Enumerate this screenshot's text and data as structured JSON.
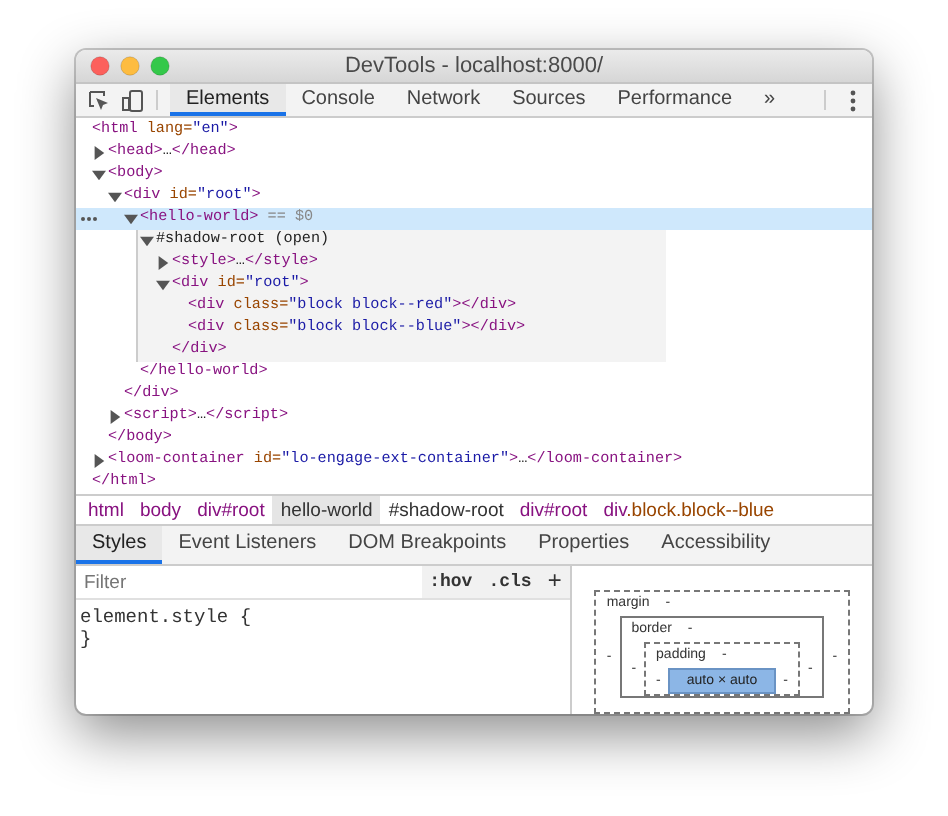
{
  "window": {
    "title": "DevTools - localhost:8000/"
  },
  "main_tabs": [
    {
      "label": "Elements",
      "selected": true
    },
    {
      "label": "Console",
      "selected": false
    },
    {
      "label": "Network",
      "selected": false
    },
    {
      "label": "Sources",
      "selected": false
    },
    {
      "label": "Performance",
      "selected": false
    },
    {
      "label": "»",
      "selected": false
    }
  ],
  "dom_tree": [
    {
      "selected": false,
      "tokens": [
        {
          "kind": "tag",
          "text": "<html"
        },
        {
          "kind": "attr",
          "text": "lang="
        },
        {
          "kind": "value",
          "text": "\"en\""
        },
        {
          "kind": "tag",
          "text": ">"
        }
      ],
      "close": "</html>",
      "children": [
        {
          "selected": false,
          "expanded": false,
          "tokens": [
            {
              "kind": "tag",
              "text": "<head>"
            },
            {
              "kind": "plain",
              "text": "…"
            },
            {
              "kind": "tag",
              "text": "</head>"
            }
          ]
        },
        {
          "selected": false,
          "expanded": true,
          "tokens": [
            {
              "kind": "tag",
              "text": "<body>"
            }
          ],
          "close": "</body>",
          "children": [
            {
              "selected": false,
              "expanded": true,
              "tokens": [
                {
                  "kind": "tag",
                  "text": "<div"
                },
                {
                  "kind": "attr",
                  "text": "id="
                },
                {
                  "kind": "value",
                  "text": "\"root\""
                },
                {
                  "kind": "tag",
                  "text": ">"
                }
              ],
              "close": "</div>",
              "children": [
                {
                  "selected": true,
                  "expanded": true,
                  "tokens": [
                    {
                      "kind": "tag",
                      "text": "<hello-world>"
                    },
                    {
                      "kind": "hint",
                      "text": "== $0"
                    }
                  ],
                  "close": "</hello-world>",
                  "children": [
                    {
                      "selected": false,
                      "expanded": true,
                      "kind": "shadow",
                      "tokens": [
                        {
                          "kind": "plain",
                          "text": "#shadow-root (open)"
                        }
                      ],
                      "children": [
                        {
                          "selected": false,
                          "expanded": false,
                          "tokens": [
                            {
                              "kind": "tag",
                              "text": "<style>"
                            },
                            {
                              "kind": "plain",
                              "text": "…"
                            },
                            {
                              "kind": "tag",
                              "text": "</style>"
                            }
                          ]
                        },
                        {
                          "selected": false,
                          "expanded": true,
                          "tokens": [
                            {
                              "kind": "tag",
                              "text": "<div"
                            },
                            {
                              "kind": "attr",
                              "text": "id="
                            },
                            {
                              "kind": "value",
                              "text": "\"root\""
                            },
                            {
                              "kind": "tag",
                              "text": ">"
                            }
                          ],
                          "close": "</div>",
                          "children": [
                            {
                              "selected": false,
                              "tokens": [
                                {
                                  "kind": "tag",
                                  "text": "<div"
                                },
                                {
                                  "kind": "attr",
                                  "text": "class="
                                },
                                {
                                  "kind": "value",
                                  "text": "\"block block--red\""
                                },
                                {
                                  "kind": "tag",
                                  "text": "></div>"
                                }
                              ]
                            },
                            {
                              "selected": false,
                              "tokens": [
                                {
                                  "kind": "tag",
                                  "text": "<div"
                                },
                                {
                                  "kind": "attr",
                                  "text": "class="
                                },
                                {
                                  "kind": "value",
                                  "text": "\"block block--blue\""
                                },
                                {
                                  "kind": "tag",
                                  "text": "></div>"
                                }
                              ]
                            }
                          ]
                        }
                      ]
                    }
                  ]
                }
              ]
            },
            {
              "selected": false,
              "expanded": false,
              "tokens": [
                {
                  "kind": "tag",
                  "text": "<script>"
                },
                {
                  "kind": "plain",
                  "text": "…"
                },
                {
                  "kind": "tag",
                  "text": "</script>"
                }
              ]
            }
          ]
        },
        {
          "selected": false,
          "expanded": false,
          "tokens": [
            {
              "kind": "tag",
              "text": "<loom-container"
            },
            {
              "kind": "attr",
              "text": "id="
            },
            {
              "kind": "value",
              "text": "\"lo-engage-ext-container\""
            },
            {
              "kind": "tag",
              "text": ">"
            },
            {
              "kind": "plain",
              "text": "…"
            },
            {
              "kind": "tag",
              "text": "</loom-container>"
            }
          ]
        }
      ]
    }
  ],
  "breadcrumbs": [
    {
      "kind": "element",
      "text": "html",
      "selected": false
    },
    {
      "kind": "element",
      "text": "body",
      "selected": false
    },
    {
      "kind": "element",
      "text": "div#root",
      "selected": false
    },
    {
      "kind": "element",
      "text": "hello-world",
      "selected": true
    },
    {
      "kind": "shadow",
      "text": "#shadow-root",
      "selected": false
    },
    {
      "kind": "element",
      "text": "div#root",
      "selected": false
    },
    {
      "kind": "element",
      "text": "div",
      "extra": ".block.block--blue",
      "selected": false
    }
  ],
  "sub_tabs": [
    {
      "label": "Styles",
      "selected": true
    },
    {
      "label": "Event Listeners",
      "selected": false
    },
    {
      "label": "DOM Breakpoints",
      "selected": false
    },
    {
      "label": "Properties",
      "selected": false
    },
    {
      "label": "Accessibility",
      "selected": false
    }
  ],
  "styles": {
    "filter": {
      "placeholder": "Filter"
    },
    "hov": ":hov",
    "cls": ".cls",
    "add": "+",
    "rule": [
      "element.style {",
      "}"
    ]
  },
  "box_model": {
    "margin": {
      "label": "margin",
      "top": "-",
      "left": "-",
      "right": "-"
    },
    "border": {
      "label": "border",
      "top": "-",
      "left": "-",
      "right": "-"
    },
    "padding": {
      "label": "padding",
      "top": "-",
      "left": "-",
      "right": "-"
    },
    "content": "auto × auto"
  }
}
